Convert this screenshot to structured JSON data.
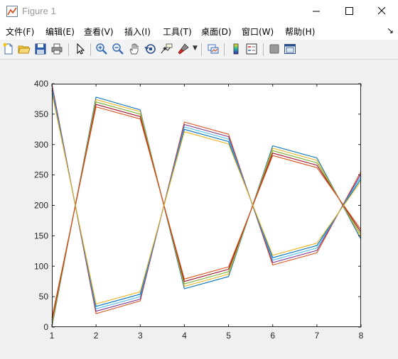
{
  "window": {
    "title": "Figure 1",
    "icon": "matlab-figure-icon",
    "controls": [
      "minimize-icon",
      "maximize-icon",
      "close-icon"
    ]
  },
  "menubar": {
    "items": [
      {
        "label": "文件(F)"
      },
      {
        "label": "编辑(E)"
      },
      {
        "label": "查看(V)"
      },
      {
        "label": "插入(I)"
      },
      {
        "label": "工具(T)"
      },
      {
        "label": "桌面(D)"
      },
      {
        "label": "窗口(W)"
      },
      {
        "label": "帮助(H)"
      }
    ],
    "overflow_icon": "dock-arrow-icon"
  },
  "toolbar": {
    "buttons": [
      "new-figure-icon",
      "open-file-icon",
      "save-icon",
      "print-icon",
      "edit-plot-icon",
      "zoom-in-icon",
      "zoom-out-icon",
      "pan-icon",
      "rotate-3d-icon",
      "data-cursor-icon",
      "brush-icon",
      "link-plot-icon",
      "insert-colorbar-icon",
      "insert-legend-icon",
      "hide-plot-tools-icon",
      "show-plot-tools-icon"
    ]
  },
  "chart_data": {
    "type": "line",
    "x": [
      1,
      2,
      3,
      4,
      5,
      6,
      7,
      8
    ],
    "xlim": [
      1,
      8
    ],
    "ylim": [
      0,
      400
    ],
    "xticks": [
      1,
      2,
      3,
      4,
      5,
      6,
      7,
      8
    ],
    "yticks": [
      0,
      50,
      100,
      150,
      200,
      250,
      300,
      350,
      400
    ],
    "grid": false,
    "title": "",
    "xlabel": "",
    "ylabel": "",
    "series": [
      {
        "color": "#0072BD",
        "values": [
          0,
          378,
          357,
          63,
          83,
          298,
          278,
          144
        ]
      },
      {
        "color": "#D95319",
        "values": [
          400,
          22,
          43,
          337,
          317,
          102,
          122,
          256
        ]
      },
      {
        "color": "#EDB120",
        "values": [
          3,
          374,
          354,
          67,
          87,
          294,
          274,
          148
        ]
      },
      {
        "color": "#7E2F8E",
        "values": [
          397,
          26,
          46,
          333,
          313,
          106,
          126,
          252
        ]
      },
      {
        "color": "#77AC30",
        "values": [
          7,
          370,
          350,
          71,
          91,
          290,
          270,
          152
        ]
      },
      {
        "color": "#4DBEEE",
        "values": [
          393,
          30,
          50,
          329,
          309,
          110,
          130,
          248
        ]
      },
      {
        "color": "#A2142F",
        "values": [
          11,
          366,
          346,
          75,
          95,
          286,
          266,
          156
        ]
      },
      {
        "color": "#0072BD",
        "values": [
          389,
          34,
          54,
          325,
          305,
          114,
          134,
          244
        ]
      },
      {
        "color": "#D95319",
        "values": [
          15,
          362,
          342,
          79,
          99,
          282,
          262,
          160
        ]
      },
      {
        "color": "#EDB120",
        "values": [
          385,
          38,
          58,
          321,
          301,
          118,
          138,
          240
        ]
      }
    ]
  }
}
